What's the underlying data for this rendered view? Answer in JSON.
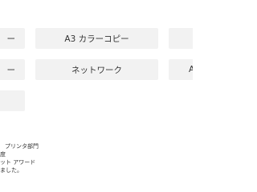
{
  "category_grid": {
    "row1": {
      "left_fragment": "ー",
      "center": "A3 カラーコピー",
      "right_fragment": ""
    },
    "row2": {
      "left_fragment": "ー",
      "center": "ネットワーク",
      "right_fragment": "A"
    },
    "row3": {
      "left_fragment": ""
    }
  },
  "award_text": {
    "line1": "プリンタ部門",
    "line2": "度",
    "line3": "ット アワード",
    "line4": "ました。"
  }
}
